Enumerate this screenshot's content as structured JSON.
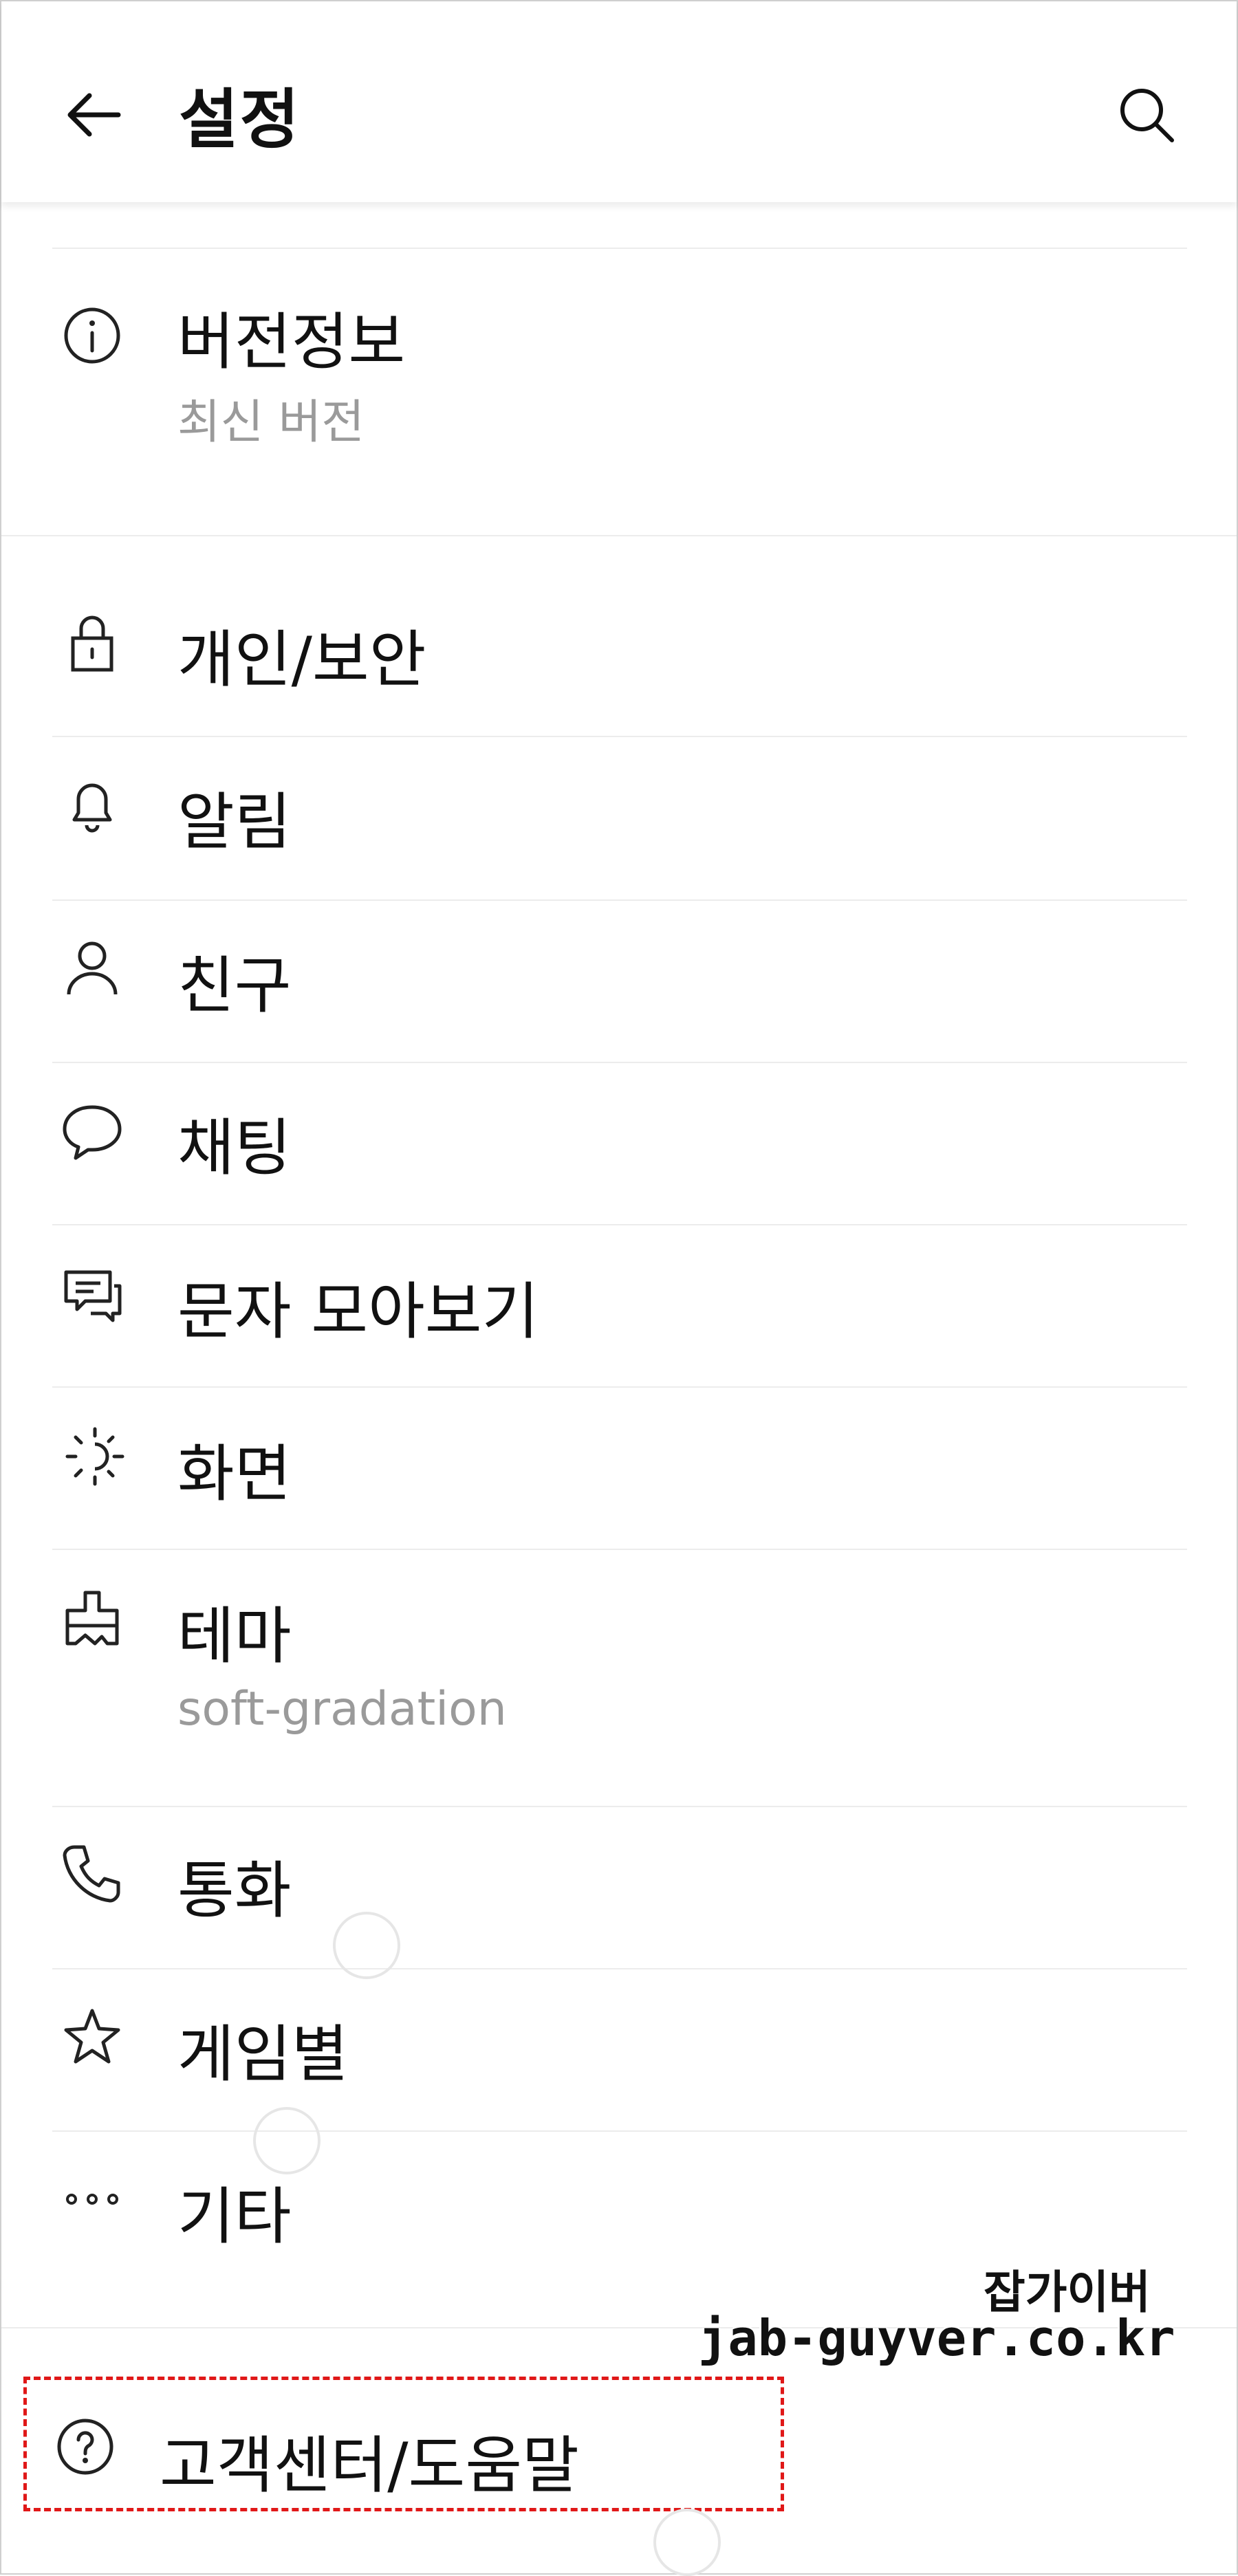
{
  "header": {
    "title": "설정"
  },
  "version_item": {
    "label": "버전정보",
    "sub": "최신 버전"
  },
  "items": [
    {
      "id": "privacy",
      "label": "개인/보안",
      "icon": "lock-icon"
    },
    {
      "id": "notifications",
      "label": "알림",
      "icon": "bell-icon"
    },
    {
      "id": "friends",
      "label": "친구",
      "icon": "person-icon"
    },
    {
      "id": "chat",
      "label": "채팅",
      "icon": "chat-bubble-icon"
    },
    {
      "id": "sms",
      "label": "문자 모아보기",
      "icon": "message-stack-icon"
    },
    {
      "id": "display",
      "label": "화면",
      "icon": "brightness-icon"
    },
    {
      "id": "theme",
      "label": "테마",
      "sub": "soft-gradation",
      "icon": "paint-brush-icon"
    },
    {
      "id": "calls",
      "label": "통화",
      "icon": "phone-icon"
    },
    {
      "id": "games",
      "label": "게임별",
      "icon": "star-icon"
    },
    {
      "id": "etc",
      "label": "기타",
      "icon": "more-dots-icon"
    }
  ],
  "help_item": {
    "label": "고객센터/도움말",
    "icon": "help-circle-icon"
  },
  "watermark": {
    "line1": "잡가이버",
    "line2": "jab-guyver.co.kr"
  },
  "colors": {
    "highlight_border": "#e01818",
    "subtext": "#9a9a9a",
    "divider": "#ececec"
  }
}
